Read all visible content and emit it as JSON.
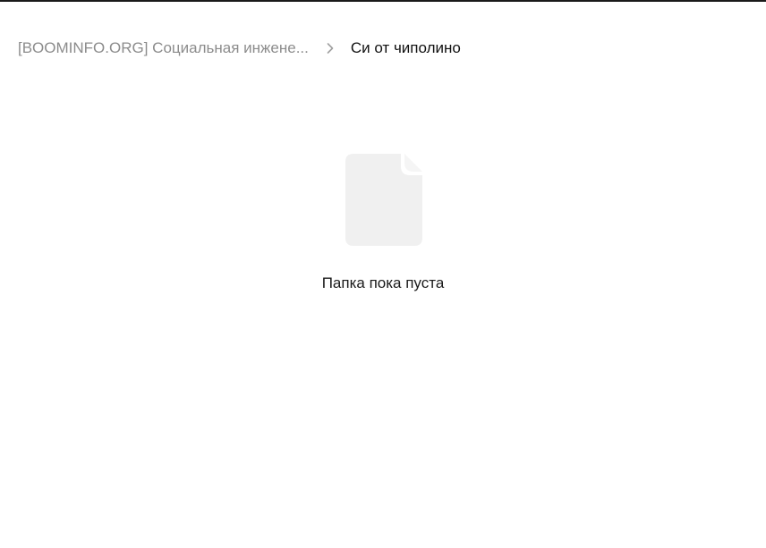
{
  "breadcrumb": {
    "parent_label": "[BOOMINFO.ORG] Социальная инжене...",
    "separator_icon": "chevron-right-icon",
    "current_label": "Си от чиполино"
  },
  "empty_state": {
    "icon": "empty-file-icon",
    "message": "Папка пока пуста"
  },
  "colors": {
    "parent_text": "#8c8c8c",
    "current_text": "#111111",
    "icon_fill": "#f0f0f0",
    "top_border": "#1a1a1a"
  }
}
